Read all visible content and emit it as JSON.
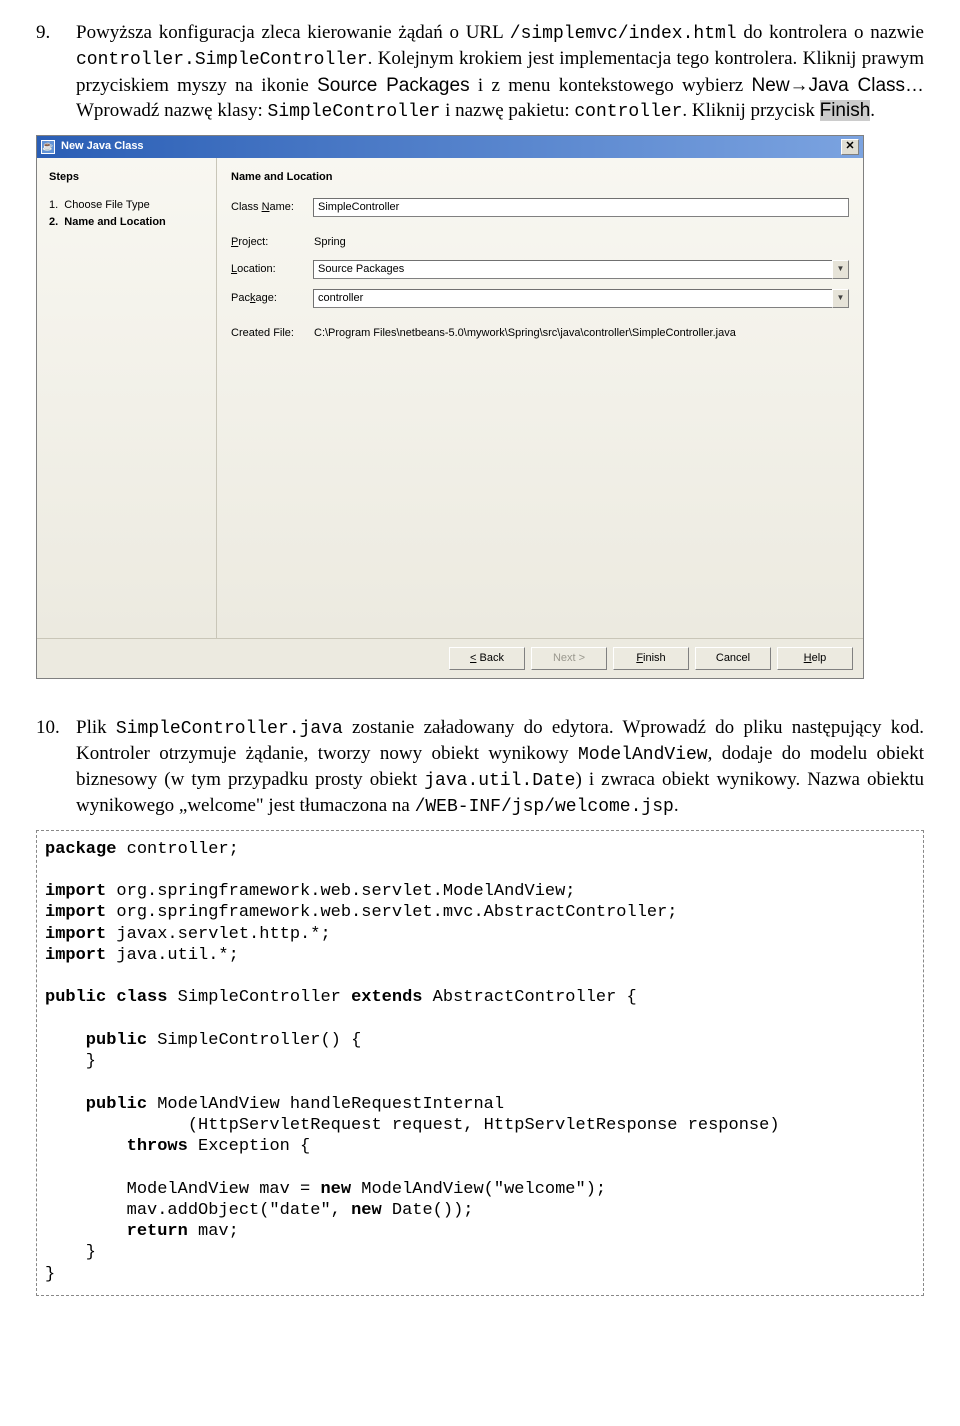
{
  "p9": {
    "num": "9.",
    "t1": "Powyższa konfiguracja zleca kierowanie żądań o URL ",
    "c1": "/simplemvc/index.html",
    "t2": " do kontrolera o nazwie ",
    "c2": "controller.SimpleController",
    "t3": ". Kolejnym krokiem jest implementacja tego kontrolera. Kliknij prawym przyciskiem myszy na ikonie ",
    "s1": "Source Packages",
    "t4": " i z menu kontekstowego wybierz ",
    "s2": "New→Java Class…",
    "t5": " Wprowadź nazwę klasy: ",
    "c3": "SimpleController",
    "t6": " i nazwę pakietu: ",
    "c4": "controller",
    "t7": ". Kliknij przycisk ",
    "s3": "Finish",
    "t8": "."
  },
  "dialog": {
    "title": "New Java Class",
    "steps_hdr": "Steps",
    "steps": [
      "Choose File Type",
      "Name and Location"
    ],
    "form_hdr": "Name and Location",
    "class_name_lbl_pre": "Class ",
    "class_name_lbl_ul": "N",
    "class_name_lbl_post": "ame:",
    "class_name_val": "SimpleController",
    "project_lbl_ul": "P",
    "project_lbl_post": "roject:",
    "project_val": "Spring",
    "location_lbl_ul": "L",
    "location_lbl_post": "ocation:",
    "location_val": "Source Packages",
    "package_lbl": "Pac",
    "package_lbl_ul": "k",
    "package_lbl_post": "age:",
    "package_val": "controller",
    "created_lbl": "Created File:",
    "created_val": "C:\\Program Files\\netbeans-5.0\\mywork\\Spring\\src\\java\\controller\\SimpleController.java",
    "btn_back": "< Back",
    "btn_next": "Next >",
    "btn_finish": "Finish",
    "btn_cancel": "Cancel",
    "btn_help": "Help"
  },
  "p10": {
    "num": "10.",
    "t1": "Plik ",
    "c1": "SimpleController.java",
    "t2": " zostanie załadowany do edytora. Wprowadź do pliku następujący kod. Kontroler otrzymuje żądanie, tworzy nowy obiekt wynikowy ",
    "c2": "ModelAndView",
    "t3": ", dodaje do modelu obiekt biznesowy (w tym przypadku prosty obiekt ",
    "c3": "java.util.Date",
    "t4": ") i zwraca obiekt wynikowy. Nazwa obiektu wynikowego „welcome\" jest tłumaczona na ",
    "c4": "/WEB-INF/jsp/welcome.jsp",
    "t5": "."
  },
  "code": {
    "l1a": "package",
    "l1b": " controller;",
    "l3a": "import",
    "l3b": " org.springframework.web.servlet.ModelAndView;",
    "l4a": "import",
    "l4b": " org.springframework.web.servlet.mvc.AbstractController;",
    "l5a": "import",
    "l5b": " javax.servlet.http.*;",
    "l6a": "import",
    "l6b": " java.util.*;",
    "l8a": "public class",
    "l8b": " SimpleController ",
    "l8c": "extends",
    "l8d": " AbstractController {",
    "l10a": "    public",
    "l10b": " SimpleController() {",
    "l11": "    }",
    "l13a": "    public",
    "l13b": " ModelAndView handleRequestInternal",
    "l14": "              (HttpServletRequest request, HttpServletResponse response)",
    "l15a": "        throws",
    "l15b": " Exception {",
    "l17a": "        ModelAndView mav = ",
    "l17b": "new",
    "l17c": " ModelAndView(\"welcome\");",
    "l18a": "        mav.addObject(\"date\", ",
    "l18b": "new",
    "l18c": " Date());",
    "l19a": "        return",
    "l19b": " mav;",
    "l20": "    }",
    "l21": "}"
  }
}
